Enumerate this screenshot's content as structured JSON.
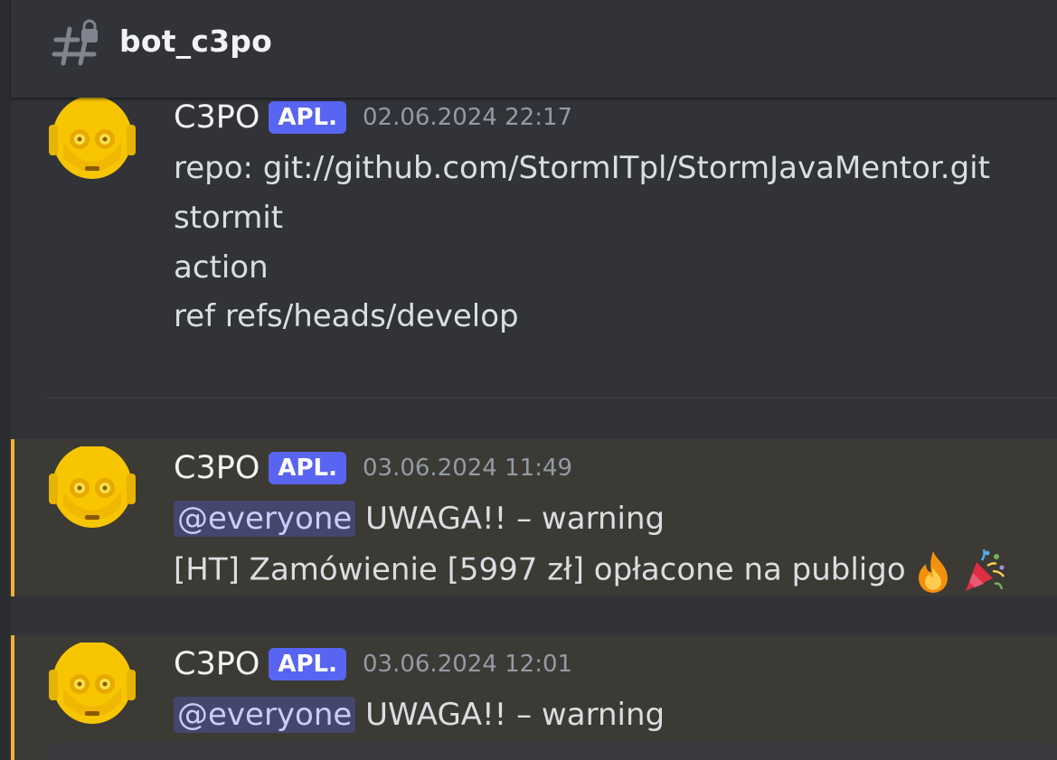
{
  "channel": {
    "name": "bot_c3po",
    "icon": "locked-text-channel-icon"
  },
  "messages": [
    {
      "author": "C3PO",
      "tag": "APL.",
      "timestamp": "02.06.2024 22:17",
      "lines": [
        "repo: git://github.com/StormITpl/StormJavaMentor.git",
        "stormit",
        "action",
        "ref refs/heads/develop"
      ]
    },
    {
      "author": "C3PO",
      "tag": "APL.",
      "timestamp": "03.06.2024 11:49",
      "mention": "@everyone",
      "warning": "UWAGA!! – warning",
      "order_text": "[HT] Zamówienie [5997 zł] opłacone na publigo",
      "emojis": [
        "fire-emoji",
        "party-popper-emoji"
      ]
    },
    {
      "author": "C3PO",
      "tag": "APL.",
      "timestamp": "03.06.2024 12:01",
      "mention": "@everyone",
      "warning": "UWAGA!! – warning"
    }
  ],
  "colors": {
    "background": "#313338",
    "highlight": "#3b3a35",
    "highlight_bar": "#f0b232",
    "app_tag": "#5865f2",
    "mention_text": "#c9cdfb"
  }
}
